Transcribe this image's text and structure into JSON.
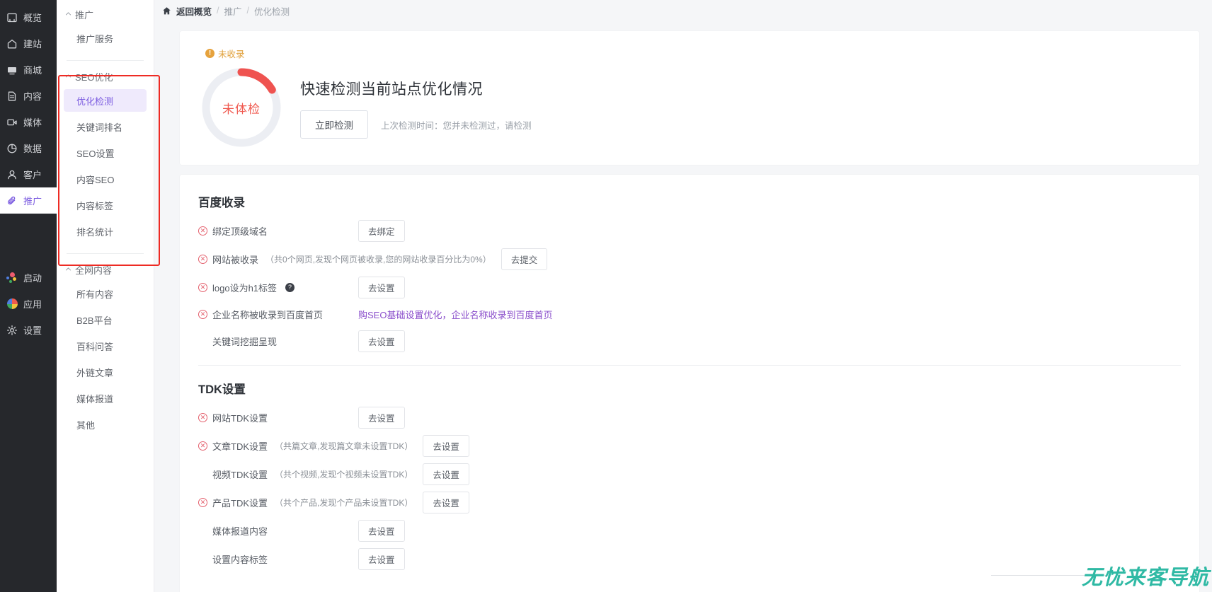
{
  "rail": {
    "items": [
      {
        "label": "概览",
        "icon": "dashboard-icon",
        "active": false
      },
      {
        "label": "建站",
        "icon": "home-icon",
        "active": false
      },
      {
        "label": "商城",
        "icon": "shop-icon",
        "active": false
      },
      {
        "label": "内容",
        "icon": "document-icon",
        "active": false
      },
      {
        "label": "媒体",
        "icon": "video-icon",
        "active": false
      },
      {
        "label": "数据",
        "icon": "chart-pie-icon",
        "active": false
      },
      {
        "label": "客户",
        "icon": "user-icon",
        "active": false
      },
      {
        "label": "推广",
        "icon": "paperclip-icon",
        "active": true
      }
    ],
    "bottom": [
      {
        "label": "启动",
        "icon": "launch-dots-icon"
      },
      {
        "label": "应用",
        "icon": "apps-pinwheel-icon"
      },
      {
        "label": "设置",
        "icon": "gear-icon"
      }
    ]
  },
  "subnav": {
    "groups": [
      {
        "title": "推广",
        "items": [
          {
            "label": "推广服务",
            "active": false
          }
        ]
      },
      {
        "title": "SEO优化",
        "items": [
          {
            "label": "优化检测",
            "active": true
          },
          {
            "label": "关键词排名",
            "active": false
          },
          {
            "label": "SEO设置",
            "active": false
          },
          {
            "label": "内容SEO",
            "active": false
          },
          {
            "label": "内容标签",
            "active": false
          },
          {
            "label": "排名统计",
            "active": false
          }
        ]
      },
      {
        "title": "全网内容",
        "items": [
          {
            "label": "所有内容",
            "active": false
          },
          {
            "label": "B2B平台",
            "active": false
          },
          {
            "label": "百科问答",
            "active": false
          },
          {
            "label": "外链文章",
            "active": false
          },
          {
            "label": "媒体报道",
            "active": false
          },
          {
            "label": "其他",
            "active": false
          }
        ]
      }
    ]
  },
  "breadcrumb": {
    "home": "返回概览",
    "sep": "/",
    "middle": "推广",
    "current": "优化检测"
  },
  "hero": {
    "badge": "未收录",
    "badge_icon": "!",
    "gauge_label": "未体检",
    "gauge_percent": 12,
    "title": "快速检测当前站点优化情况",
    "detect_button": "立即检测",
    "meta": "上次检测时间：您并未检测过，请检测"
  },
  "sections": [
    {
      "title": "百度收录",
      "rows": [
        {
          "status": "fail",
          "label": "绑定顶级域名",
          "note": "",
          "help": false,
          "action": "去绑定",
          "link": ""
        },
        {
          "status": "fail",
          "label": "网站被收录",
          "note": "（共0个网页,发现个网页被收录,您的网站收录百分比为0%）",
          "help": false,
          "action": "去提交",
          "link": ""
        },
        {
          "status": "fail",
          "label": "logo设为h1标签",
          "note": "",
          "help": true,
          "action": "去设置",
          "link": ""
        },
        {
          "status": "fail",
          "label": "企业名称被收录到百度首页",
          "note": "",
          "help": false,
          "action": "",
          "link": "购SEO基础设置优化，企业名称收录到百度首页"
        },
        {
          "status": "none",
          "label": "关键词挖掘呈现",
          "note": "",
          "help": false,
          "action": "去设置",
          "link": ""
        }
      ]
    },
    {
      "title": "TDK设置",
      "rows": [
        {
          "status": "fail",
          "label": "网站TDK设置",
          "note": "",
          "help": false,
          "action": "去设置",
          "link": ""
        },
        {
          "status": "fail",
          "label": "文章TDK设置",
          "note": "（共篇文章,发现篇文章未设置TDK）",
          "help": false,
          "action": "去设置",
          "link": ""
        },
        {
          "status": "none",
          "label": "视频TDK设置",
          "note": "（共个视频,发现个视频未设置TDK）",
          "help": false,
          "action": "去设置",
          "link": ""
        },
        {
          "status": "fail",
          "label": "产品TDK设置",
          "note": "（共个产品,发现个产品未设置TDK）",
          "help": false,
          "action": "去设置",
          "link": ""
        },
        {
          "status": "none",
          "label": "媒体报道内容",
          "note": "",
          "help": false,
          "action": "去设置",
          "link": ""
        },
        {
          "status": "none",
          "label": "设置内容标签",
          "note": "",
          "help": false,
          "action": "去设置",
          "link": ""
        }
      ]
    }
  ],
  "watermark": "无忧来客导航",
  "colors": {
    "accent": "#7a5ae0",
    "danger": "#e4606d",
    "warning": "#e0a03a",
    "gauge_arc": "#ef5350",
    "link": "#8a4ecb",
    "watermark": "#2fb9a4",
    "annotation": "#ee2b24"
  }
}
